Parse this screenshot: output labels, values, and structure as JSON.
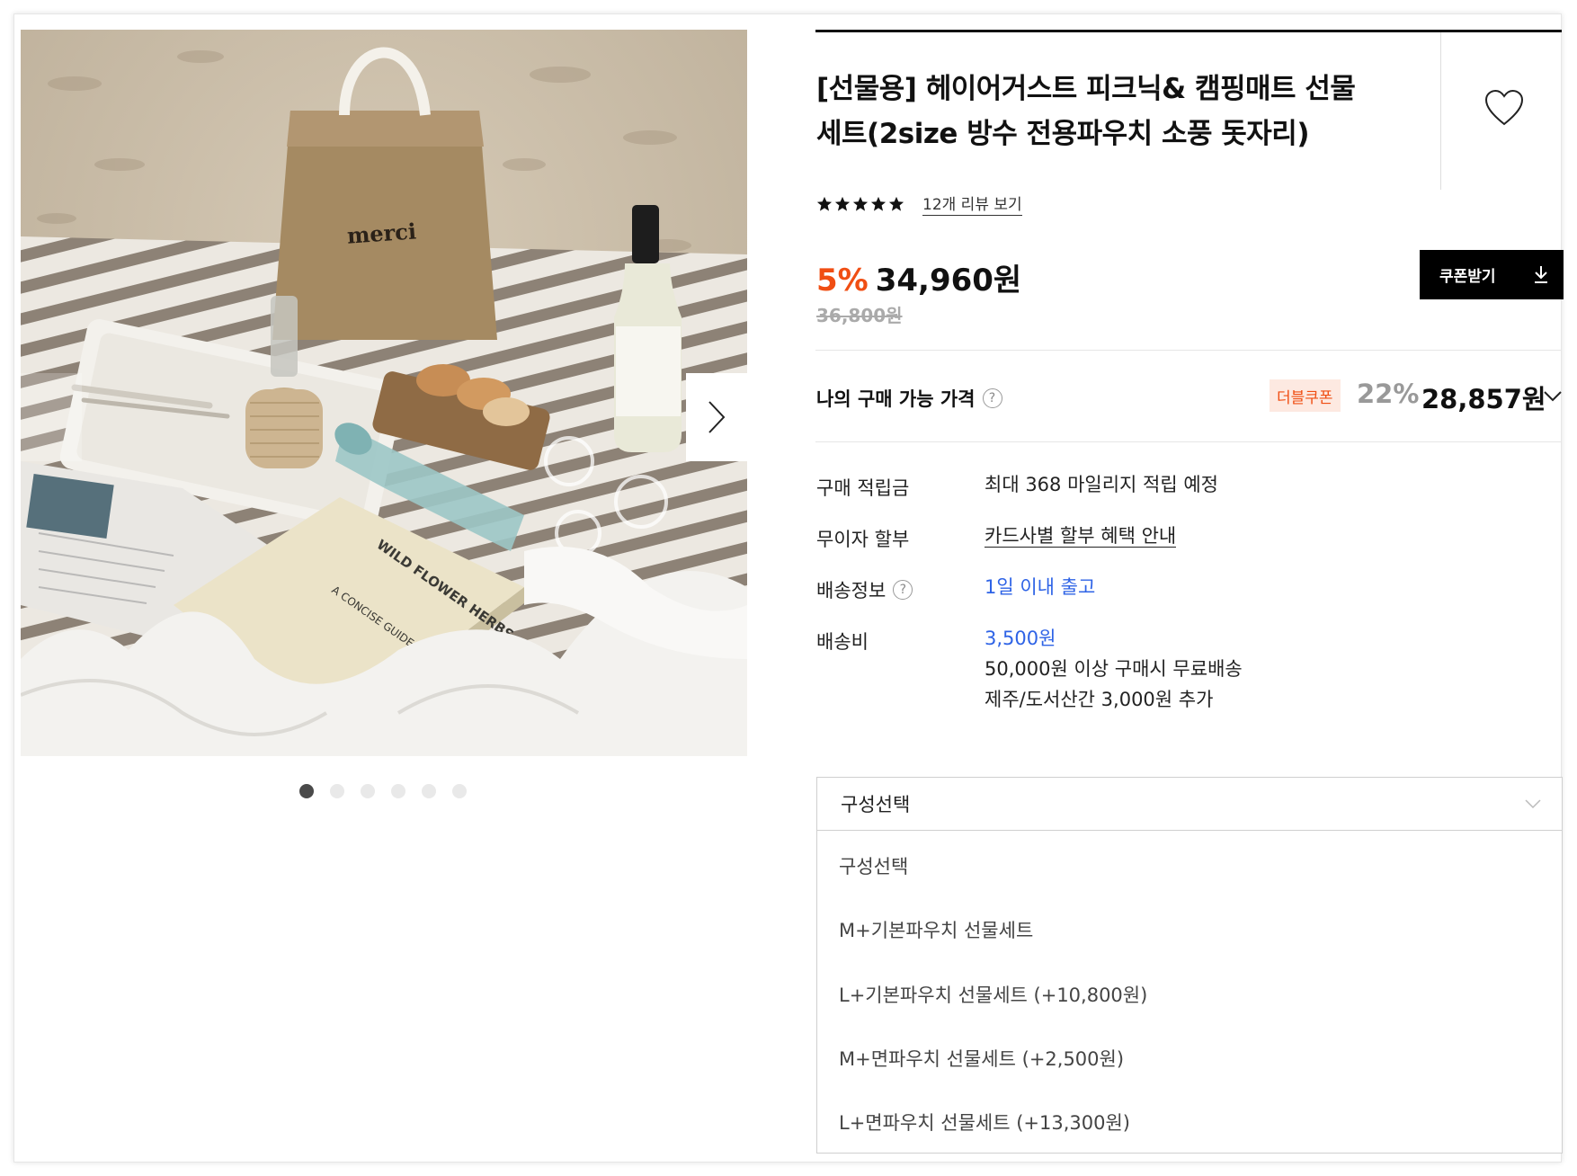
{
  "product": {
    "title_line1": "[선물용] 헤이어거스트 피크닉& 캠핑매트 선물",
    "title_line2": "세트(2size 방수 전용파우치 소풍 돗자리)",
    "rating_stars": 5,
    "review_link": "12개 리뷰 보기",
    "discount_rate": "5%",
    "price": "34,960원",
    "original_price": "36,800원",
    "coupon_button": "쿠폰받기"
  },
  "gallery": {
    "photo_bag_text": "merci",
    "photo_book_text": "WILD FLOWER HERBS",
    "photo_book_subtext": "A CONCISE GUIDE IN COLOUR",
    "slide_count": 6,
    "active_slide": 1
  },
  "my_price": {
    "label": "나의 구매 가능 가격",
    "badge": "더블쿠폰",
    "rate": "22%",
    "price": "28,857원"
  },
  "info": {
    "points_label": "구매 적립금",
    "points_value": "최대 368 마일리지 적립 예정",
    "installment_label": "무이자 할부",
    "installment_value": "카드사별 할부 혜택 안내",
    "shipping_label": "배송정보",
    "shipping_value": "1일 이내 출고",
    "fee_label": "배송비",
    "fee_value": "3,500원",
    "fee_note1": "50,000원 이상 구매시 무료배송",
    "fee_note2": "제주/도서산간 3,000원 추가"
  },
  "option_select": {
    "selected": "구성선택",
    "options": [
      "구성선택",
      "M+기본파우치 선물세트",
      "L+기본파우치 선물세트 (+10,800원)",
      "M+면파우치 선물세트 (+2,500원)",
      "L+면파우치 선물세트 (+13,300원)"
    ]
  },
  "colors": {
    "accent": "#f04e13",
    "link_blue": "#2e63e6",
    "coupon_bg": "#fde9e1"
  }
}
